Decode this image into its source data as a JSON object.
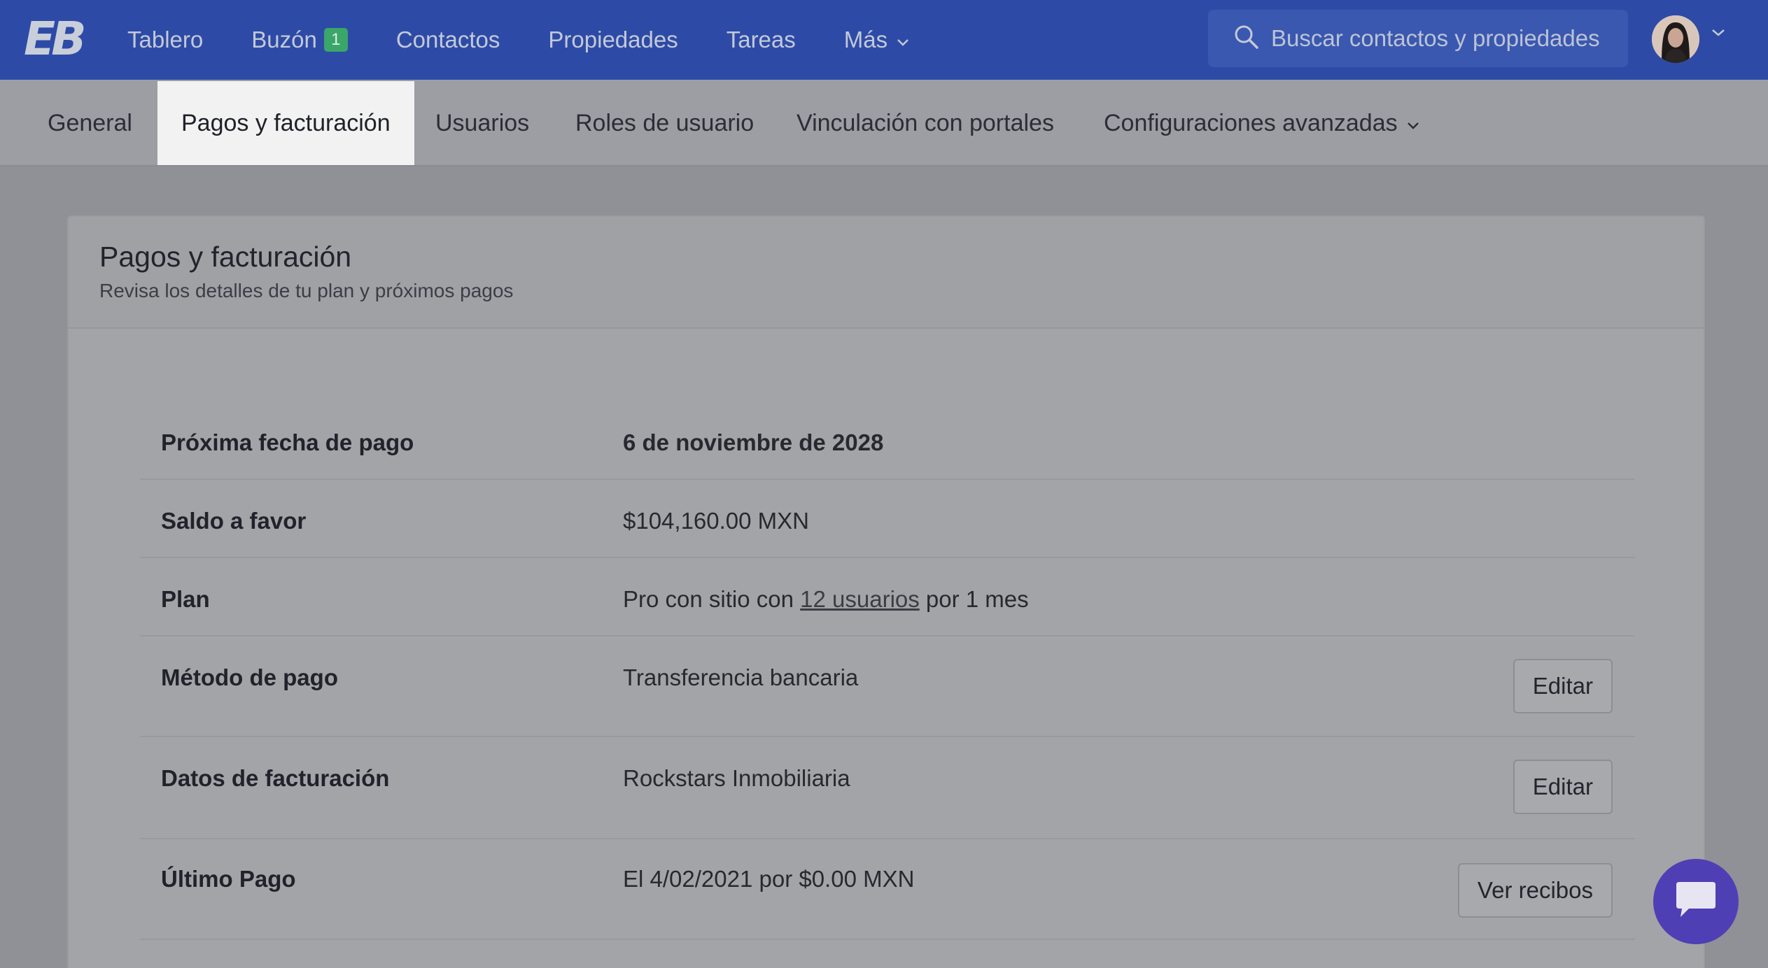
{
  "nav": {
    "logo": "EB",
    "items": [
      {
        "label": "Tablero"
      },
      {
        "label": "Buzón",
        "badge": "1"
      },
      {
        "label": "Contactos"
      },
      {
        "label": "Propiedades"
      },
      {
        "label": "Tareas"
      },
      {
        "label": "Más"
      }
    ],
    "search_placeholder": "Buscar contactos y propiedades"
  },
  "tabs": [
    {
      "label": "General"
    },
    {
      "label": "Pagos y facturación",
      "active": true
    },
    {
      "label": "Usuarios"
    },
    {
      "label": "Roles de usuario"
    },
    {
      "label": "Vinculación con portales"
    },
    {
      "label": "Configuraciones avanzadas"
    }
  ],
  "card": {
    "title": "Pagos y facturación",
    "subtitle": "Revisa los detalles de tu plan y próximos pagos"
  },
  "rows": {
    "next_payment": {
      "label": "Próxima fecha de pago",
      "value": "6 de noviembre de 2028"
    },
    "balance": {
      "label": "Saldo a favor",
      "value": "$104,160.00 MXN"
    },
    "plan": {
      "label": "Plan",
      "prefix": "Pro con sitio con",
      "link": "12 usuarios",
      "suffix": "por 1 mes"
    },
    "payment_method": {
      "label": "Método de pago",
      "value": "Transferencia bancaria",
      "button": "Editar"
    },
    "billing": {
      "label": "Datos de facturación",
      "value": "Rockstars Inmobiliaria",
      "button": "Editar"
    },
    "last_payment": {
      "label": "Último Pago",
      "value": "El 4/02/2021 por $0.00 MXN",
      "button": "Ver recibos"
    }
  },
  "colors": {
    "nav_bg": "#2d4ba6",
    "badge_bg": "#3aa669",
    "chat_fab": "#4f3fb5"
  }
}
